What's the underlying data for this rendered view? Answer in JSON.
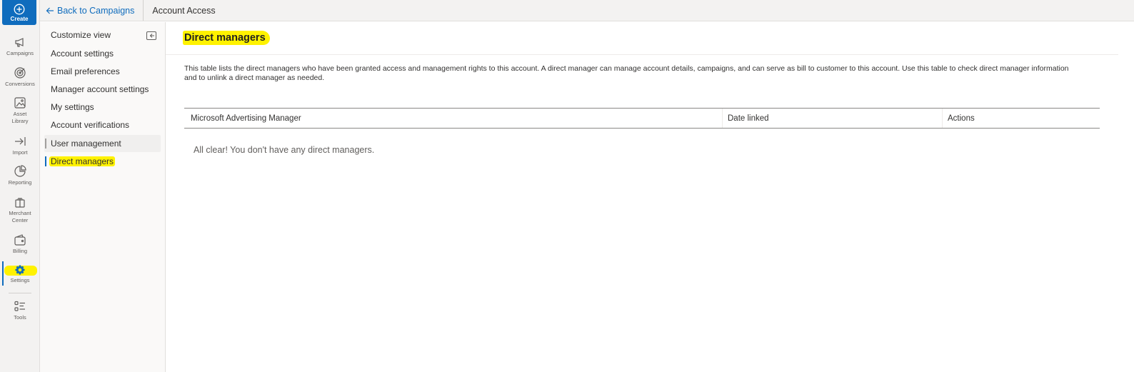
{
  "topbar": {
    "back_label": "Back to Campaigns",
    "title": "Account Access"
  },
  "rail": {
    "create_label": "Create",
    "items": [
      {
        "id": "campaigns",
        "label": "Campaigns",
        "icon": "megaphone-icon"
      },
      {
        "id": "conversions",
        "label": "Conversions",
        "icon": "target-icon"
      },
      {
        "id": "asset-library",
        "label": "Asset Library",
        "icon": "image-edit-icon"
      },
      {
        "id": "import",
        "label": "Import",
        "icon": "import-arrow-icon"
      },
      {
        "id": "reporting",
        "label": "Reporting",
        "icon": "pie-chart-icon"
      },
      {
        "id": "merchant-center",
        "label": "Merchant Center",
        "icon": "gift-bag-icon"
      },
      {
        "id": "billing",
        "label": "Billing",
        "icon": "wallet-icon"
      },
      {
        "id": "settings",
        "label": "Settings",
        "icon": "gear-icon",
        "active": true
      },
      {
        "id": "tools",
        "label": "Tools",
        "icon": "tools-list-icon"
      }
    ]
  },
  "subnav": {
    "items": [
      {
        "label": "Customize view"
      },
      {
        "label": "Account settings"
      },
      {
        "label": "Email preferences"
      },
      {
        "label": "Manager account settings"
      },
      {
        "label": "My settings"
      },
      {
        "label": "Account verifications"
      },
      {
        "label": "User management"
      },
      {
        "label": "Direct managers",
        "active": true
      }
    ]
  },
  "main": {
    "title": "Direct managers",
    "description": "This table lists the direct managers who have been granted access and management rights to this account. A direct manager can manage account details, campaigns, and can serve as bill to customer to this account. Use this table to check direct manager information and to unlink a direct manager as needed.",
    "table": {
      "columns": [
        "Microsoft Advertising Manager",
        "Date linked",
        "Actions"
      ],
      "empty_message": "All clear! You don't have any direct managers."
    }
  },
  "colors": {
    "accent": "#0f6cbd",
    "highlight": "#fff200"
  }
}
